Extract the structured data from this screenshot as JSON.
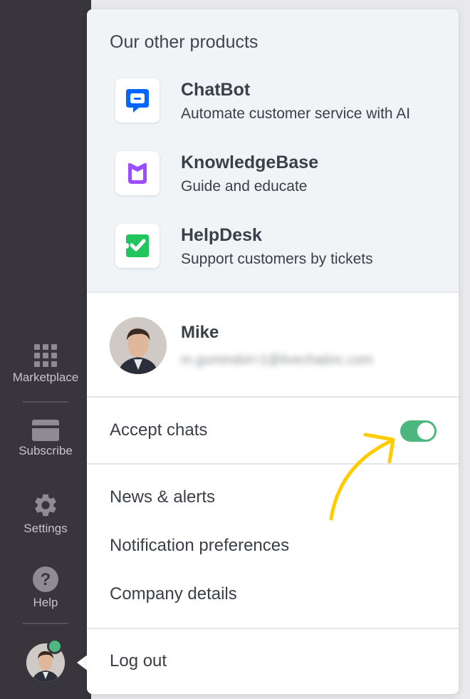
{
  "sidebar": {
    "items": [
      {
        "label": "Marketplace",
        "icon": "grid-icon"
      },
      {
        "label": "Subscribe",
        "icon": "card-icon"
      },
      {
        "label": "Settings",
        "icon": "gear-icon"
      },
      {
        "label": "Help",
        "icon": "question-icon"
      }
    ],
    "status_color": "#4cb77f"
  },
  "menu": {
    "products_title": "Our other products",
    "products": [
      {
        "name": "ChatBot",
        "description": "Automate customer service with AI",
        "icon": "chatbot-logo-icon",
        "color": "#0066ff"
      },
      {
        "name": "KnowledgeBase",
        "description": "Guide and educate",
        "icon": "knowledgebase-logo-icon",
        "color": "#9b4dff"
      },
      {
        "name": "HelpDesk",
        "description": "Support customers by tickets",
        "icon": "helpdesk-logo-icon",
        "color": "#22c55e"
      }
    ],
    "user": {
      "name": "Mike",
      "email": "m.gumindot+1@livechatinc.com"
    },
    "accept_chats": {
      "label": "Accept chats",
      "enabled": true,
      "color": "#4cb77f"
    },
    "links": [
      {
        "label": "News & alerts"
      },
      {
        "label": "Notification preferences"
      },
      {
        "label": "Company details"
      }
    ],
    "logout": "Log out"
  },
  "annotation": {
    "arrow_color": "#ffcc00"
  }
}
